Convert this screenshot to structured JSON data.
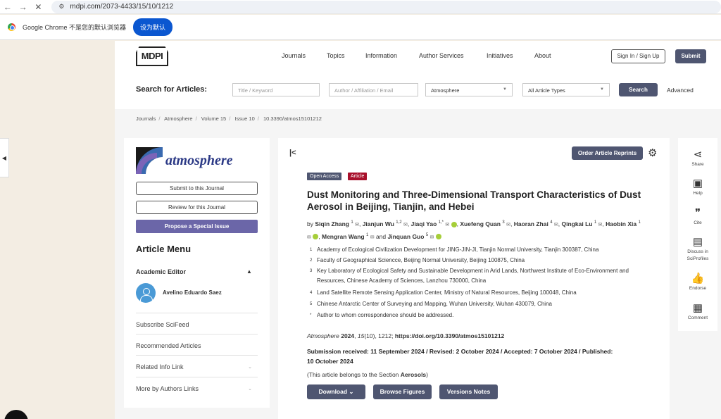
{
  "browser": {
    "back": "←",
    "forward": "→",
    "stop": "✕",
    "url": "mdpi.com/2073-4433/15/10/1212",
    "infobar_text": "Google Chrome 不是您的默认浏览器",
    "set_default": "设为默认"
  },
  "header": {
    "logo": "MDPI",
    "nav": [
      "Journals",
      "Topics",
      "Information",
      "Author Services",
      "Initiatives",
      "About"
    ],
    "sign_in": "Sign In / Sign Up",
    "submit": "Submit"
  },
  "search": {
    "label": "Search for Articles:",
    "title_placeholder": "Title / Keyword",
    "author_placeholder": "Author / Affiliation / Email",
    "journal_select": "Atmosphere",
    "type_select": "All Article Types",
    "search_btn": "Search",
    "advanced": "Advanced"
  },
  "breadcrumb": [
    "Journals",
    "Atmosphere",
    "Volume 15",
    "Issue 10",
    "10.3390/atmos15101212"
  ],
  "sidebar": {
    "journal_name": "atmosphere",
    "submit_to_journal": "Submit to this Journal",
    "review_for_journal": "Review for this Journal",
    "propose_issue": "Propose a Special Issue",
    "menu_title": "Article Menu",
    "academic_editor_label": "Academic Editor",
    "editor_name": "Avelino Eduardo Saez",
    "items": [
      "Subscribe SciFeed",
      "Recommended Articles",
      "Related Info Link",
      "More by Authors Links"
    ]
  },
  "article": {
    "order_reprints": "Order Article Reprints",
    "badge_open": "Open Access",
    "badge_type": "Article",
    "title": "Dust Monitoring and Three-Dimensional Transport Characteristics of Dust Aerosol in Beijing, Tianjin, and Hebei",
    "by": "by",
    "and": "and",
    "authors": [
      {
        "name": "Siqin Zhang",
        "sup": "1"
      },
      {
        "name": "Jianjun Wu",
        "sup": "1,2"
      },
      {
        "name": "Jiaqi Yao",
        "sup": "1,*"
      },
      {
        "name": "Xuefeng Quan",
        "sup": "3"
      },
      {
        "name": "Haoran Zhai",
        "sup": "4"
      },
      {
        "name": "Qingkai Lu",
        "sup": "1"
      },
      {
        "name": "Haobin Xia",
        "sup": "1"
      },
      {
        "name": "Mengran Wang",
        "sup": "1"
      },
      {
        "name": "Jinquan Guo",
        "sup": "5"
      }
    ],
    "affiliations": [
      {
        "n": "1",
        "text": "Academy of Ecological Civilization Development for JING-JIN-JI, Tianjin Normal University, Tianjin 300387, China"
      },
      {
        "n": "2",
        "text": "Faculty of Geographical Sciencce, Beijing Normal University, Beijing 100875, China"
      },
      {
        "n": "3",
        "text": "Key Laboratory of Ecological Safety and Sustainable Development in Arid Lands, Northwest Institute of Eco-Environment and Resources, Chinese Academy of Sciences, Lanzhou 730000, China"
      },
      {
        "n": "4",
        "text": "Land Satellite Remote Sensing Application Center, Ministry of Natural Resources, Beijing 100048, China"
      },
      {
        "n": "5",
        "text": "Chinese Antarctic Center of Surveying and Mapping, Wuhan University, Wuhan 430079, China"
      },
      {
        "n": "*",
        "text": "Author to whom correspondence should be addressed."
      }
    ],
    "citation_journal": "Atmosphere",
    "citation_year": "2024",
    "citation_volume": "15",
    "citation_rest": "(10), 1212;",
    "doi": "https://doi.org/10.3390/atmos15101212",
    "dates": "Submission received: 11 September 2024 / Revised: 2 October 2024 / Accepted: 7 October 2024 / Published: 10 October 2024",
    "section_prefix": "(This article belongs to the Section",
    "section_name": "Aerosols",
    "section_suffix": ")",
    "download": "Download",
    "browse_figures": "Browse Figures",
    "versions_notes": "Versions Notes"
  },
  "right_sidebar": {
    "share": "Share",
    "help": "Help",
    "cite": "Cite",
    "discuss": "Discuss in SciProfiles",
    "endorse": "Endorse",
    "comment": "Comment"
  }
}
